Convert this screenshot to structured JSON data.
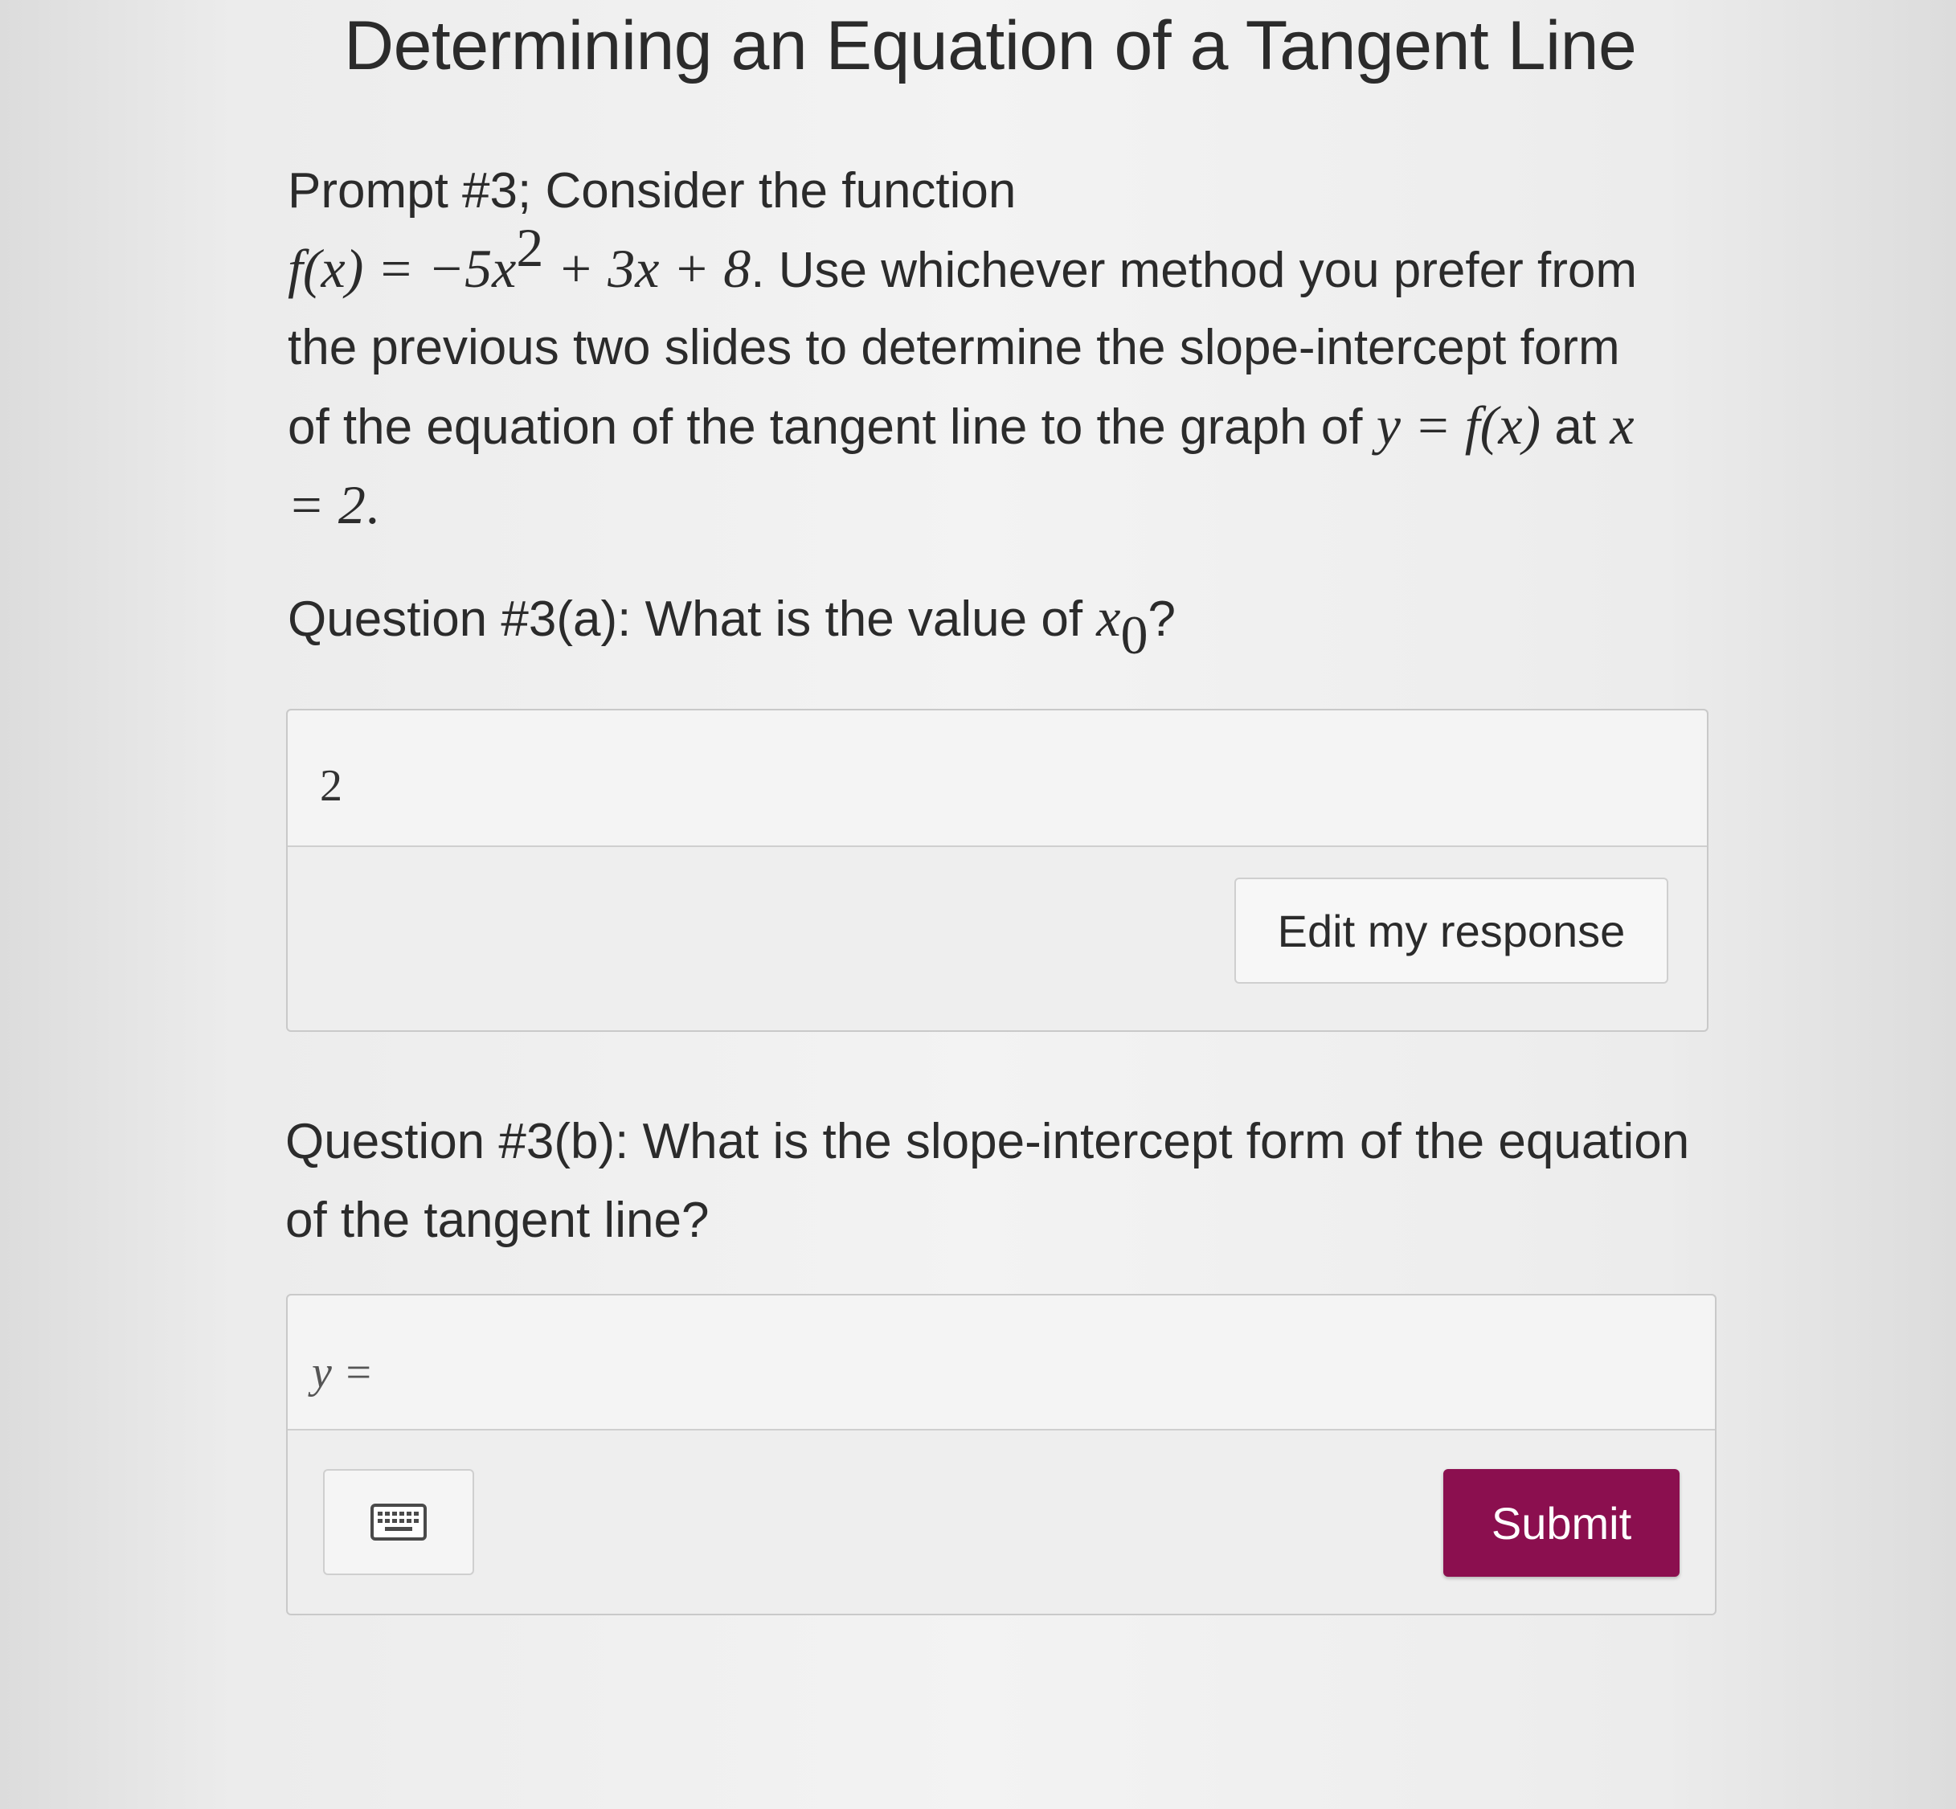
{
  "title": "Determining an Equation of a Tangent Line",
  "prompt": {
    "lead": "Prompt #3; Consider the function",
    "func_lhs": "f(x) = −5x",
    "func_exp": "2",
    "func_rhs": " + 3x + 8",
    "mid": ". Use whichever method you prefer from the previous two slides to determine the slope-intercept form of the equation of the tangent line to the graph of ",
    "graph_expr": "y = f(x)",
    "at": " at ",
    "point_expr": "x = 2",
    "end": "."
  },
  "question_a": {
    "text": "Question #3(a): What is the value of ",
    "var": "x",
    "sub": "0",
    "qmark": "?",
    "answer": "2",
    "edit_label": "Edit my response"
  },
  "question_b": {
    "text": "Question #3(b): What is the slope-intercept form of the equation of the tangent line?",
    "input_prefix": "y =",
    "keyboard_icon": "keyboard-icon",
    "submit_label": "Submit"
  },
  "colors": {
    "submit_bg": "#8b0f4f",
    "text": "#2b2b2b"
  }
}
